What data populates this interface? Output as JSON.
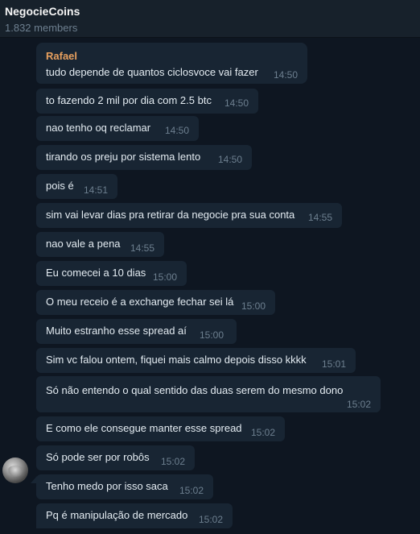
{
  "header": {
    "title": "NegocieCoins",
    "subtitle": "1.832 members"
  },
  "messages": [
    {
      "sender": "Rafael",
      "text": "tudo depende de quantos ciclosvoce vai fazer",
      "time": "14:50"
    },
    {
      "text": "to fazendo 2 mil por dia com 2.5 btc",
      "time": "14:50"
    },
    {
      "text": "nao tenho oq reclamar",
      "time": "14:50"
    },
    {
      "text": "tirando os preju por sistema lento",
      "time": "14:50"
    },
    {
      "text": "pois é",
      "time": "14:51"
    },
    {
      "text": "sim vai levar dias pra retirar da negocie pra sua conta",
      "time": "14:55"
    },
    {
      "text": "nao vale a pena",
      "time": "14:55"
    },
    {
      "text": "Eu comecei a 10 dias",
      "time": "15:00"
    },
    {
      "text": "O meu receio é a exchange fechar sei lá",
      "time": "15:00"
    },
    {
      "text": "Muito estranho esse spread aí",
      "time": "15:00"
    },
    {
      "text": "Sim vc falou ontem, fiquei mais calmo depois disso kkkk",
      "time": "15:01"
    },
    {
      "text": "Só não entendo o qual sentido das duas serem do mesmo dono",
      "time": "15:02"
    },
    {
      "text": "E como ele consegue manter esse spread",
      "time": "15:02"
    },
    {
      "text": "Só pode ser por robôs",
      "time": "15:02"
    },
    {
      "text": "Tenho medo por isso saca",
      "time": "15:02"
    },
    {
      "text": "Pq é manipulação de mercado",
      "time": "15:02"
    }
  ]
}
